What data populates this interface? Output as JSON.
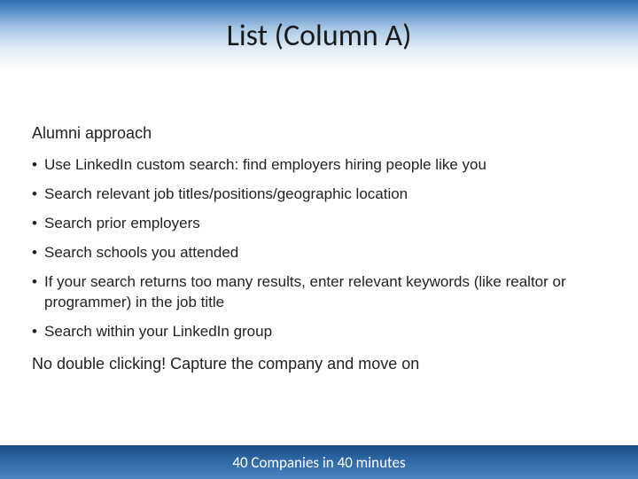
{
  "title": "List (Column A)",
  "lead": "Alumni approach",
  "bullets": [
    "Use LinkedIn custom search:  find employers hiring people like you",
    "Search relevant job titles/positions/geographic location",
    "Search prior employers",
    "Search schools you attended",
    "If your search returns too many results, enter relevant keywords (like realtor or programmer) in the job title",
    "Search within your LinkedIn group"
  ],
  "closing": "No double clicking!  Capture the company and move on",
  "footer": "40 Companies in 40 minutes"
}
